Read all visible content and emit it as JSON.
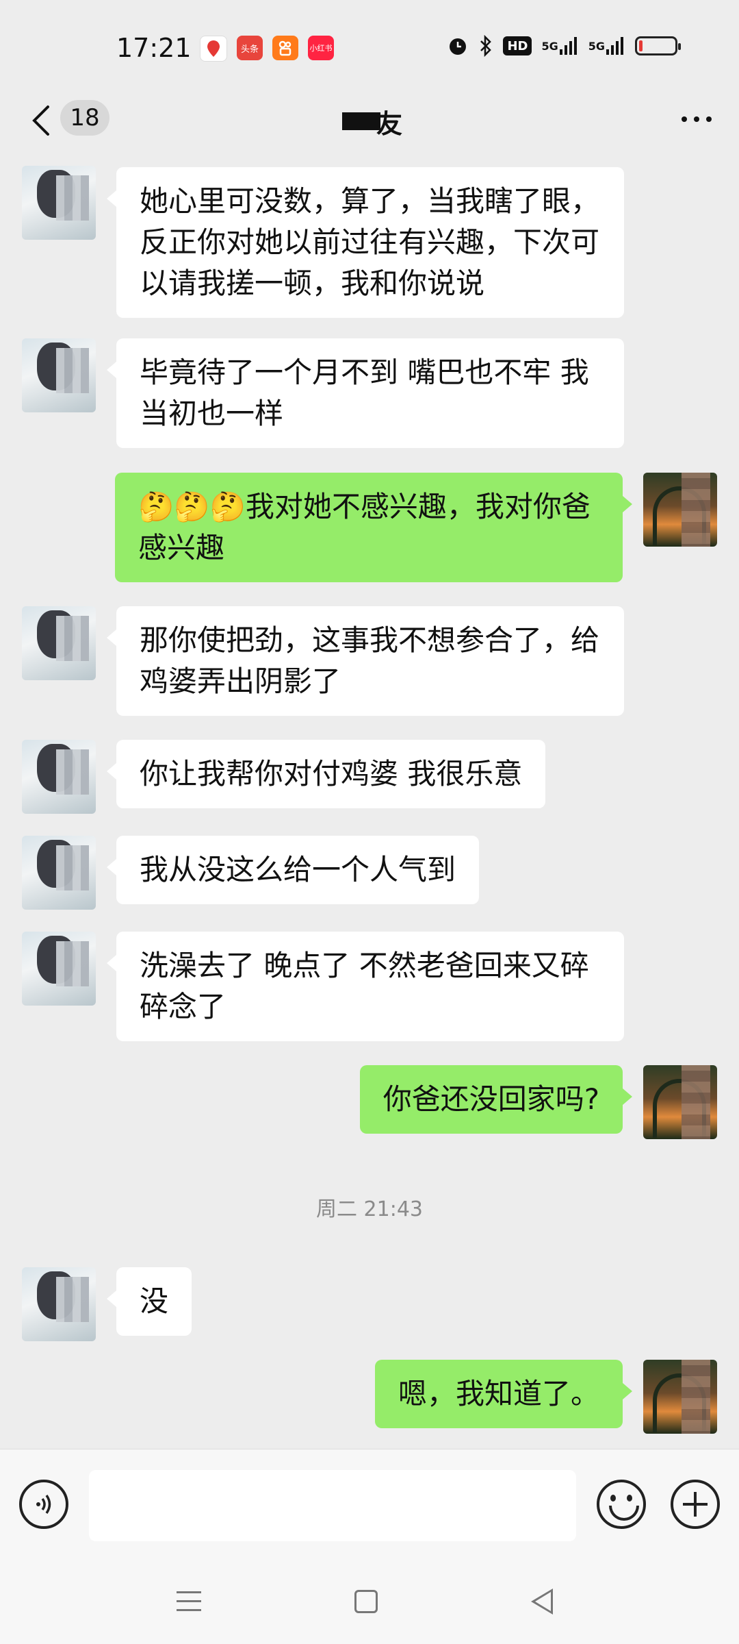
{
  "status_bar": {
    "time": "17:21",
    "apps": [
      {
        "name": "location-app-icon",
        "label": "",
        "color": "#ffffff"
      },
      {
        "name": "toutiao-app-icon",
        "label": "头条",
        "color": "#e8453c"
      },
      {
        "name": "kuaishou-app-icon",
        "label": "",
        "color": "#ff7a1a"
      },
      {
        "name": "xiaohongshu-app-icon",
        "label": "小红书",
        "color": "#ff2442"
      }
    ],
    "indicators": {
      "hd": "HD",
      "net1": "5G",
      "net2": "5G"
    },
    "battery_level": 0.1
  },
  "header": {
    "back_label": "<",
    "unread_count": "18",
    "title": "友"
  },
  "messages": [
    {
      "side": "in",
      "text": "她心里可没数，算了，当我瞎了眼，反正你对她以前过往有兴趣，下次可以请我搓一顿，我和你说说"
    },
    {
      "side": "in",
      "text": "毕竟待了一个月不到 嘴巴也不牢 我当初也一样"
    },
    {
      "side": "out",
      "text": "🤔🤔🤔我对她不感兴趣，我对你爸感兴趣"
    },
    {
      "side": "in",
      "text": "那你使把劲，这事我不想参合了，给鸡婆弄出阴影了"
    },
    {
      "side": "in",
      "text": "你让我帮你对付鸡婆 我很乐意"
    },
    {
      "side": "in",
      "text": "我从没这么给一个人气到"
    },
    {
      "side": "in",
      "text": "洗澡去了 晚点了 不然老爸回来又碎碎念了"
    },
    {
      "side": "out",
      "text": "你爸还没回家吗?"
    },
    {
      "side": "in",
      "text": "没"
    },
    {
      "side": "out",
      "text": "嗯，我知道了。"
    }
  ],
  "timestamp": "周二 21:43",
  "input": {
    "value": "",
    "placeholder": ""
  },
  "colors": {
    "outgoing_bubble": "#95ec69",
    "incoming_bubble": "#ffffff",
    "background": "#ededed"
  }
}
